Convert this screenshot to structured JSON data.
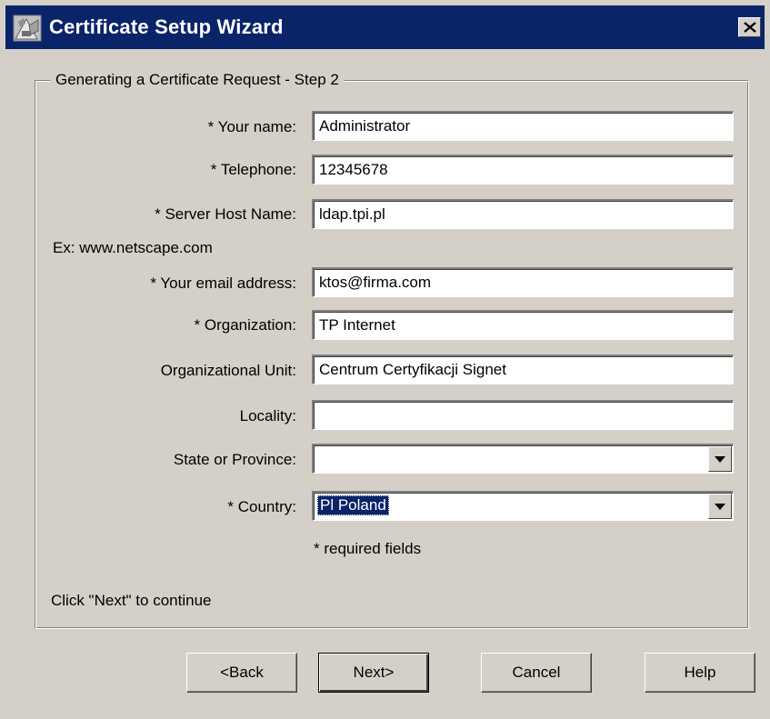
{
  "window": {
    "title": "Certificate Setup Wizard",
    "title_icon": "certificate-icon",
    "close_icon": "close-icon",
    "colors": {
      "titlebar": "#0a246a",
      "face": "#d4d0c8",
      "selection": "#0a246a"
    }
  },
  "group": {
    "title": "Generating a Certificate Request - Step 2"
  },
  "fields": {
    "your_name": {
      "label": "* Your name:",
      "value": "Administrator"
    },
    "telephone": {
      "label": "* Telephone:",
      "value": "12345678"
    },
    "server_host": {
      "label": "* Server Host Name:",
      "value": "ldap.tpi.pl",
      "hint": "Ex: www.netscape.com"
    },
    "email": {
      "label": "* Your email address:",
      "value": "ktos@firma.com"
    },
    "organization": {
      "label": "* Organization:",
      "value": "TP Internet"
    },
    "org_unit": {
      "label": "Organizational Unit:",
      "value": "Centrum Certyfikacji Signet"
    },
    "locality": {
      "label": "Locality:",
      "value": ""
    },
    "state": {
      "label": "State or Province:",
      "value": ""
    },
    "country": {
      "label": "* Country:",
      "value": "Pl Poland"
    }
  },
  "required_note": "* required fields",
  "continue_text": "Click \"Next\" to continue",
  "buttons": {
    "back": "<Back",
    "next": "Next>",
    "cancel": "Cancel",
    "help": "Help"
  }
}
